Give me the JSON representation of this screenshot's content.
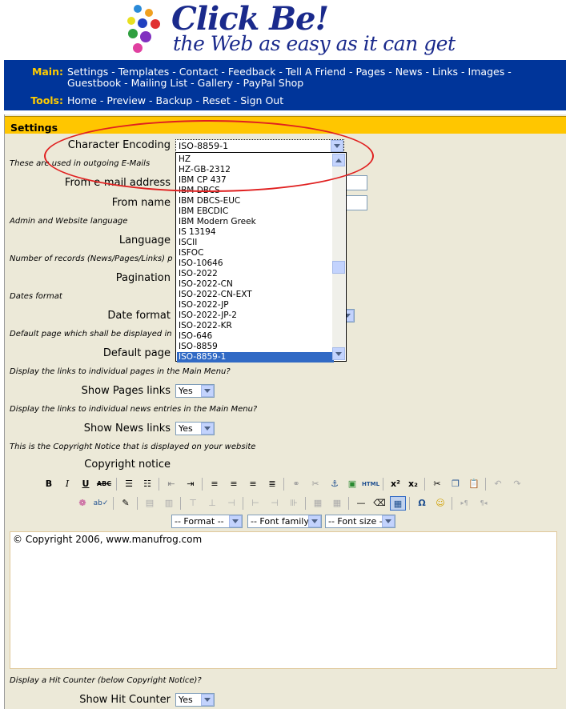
{
  "header": {
    "logo_title": "Click Be!",
    "logo_subtitle": "the Web as easy as it can get"
  },
  "nav": {
    "main_label": "Main:",
    "main_links_row1": [
      "Settings",
      "Templates",
      "Contact",
      "Feedback",
      "Tell A Friend",
      "Pages",
      "News",
      "Links",
      "Images"
    ],
    "main_links_row2": [
      "Guestbook",
      "Mailing List",
      "Gallery",
      "PayPal Shop"
    ],
    "tools_label": "Tools:",
    "tools_links": [
      "Home",
      "Preview",
      "Backup",
      "Reset",
      "Sign Out"
    ]
  },
  "settings": {
    "title": "Settings",
    "char_encoding_label": "Character Encoding",
    "char_encoding_value": "ISO-8859-1",
    "note_email": "These are used in outgoing E-Mails",
    "from_email_label": "From e-mail address",
    "from_name_label": "From name",
    "note_language": "Admin and Website language",
    "language_label": "Language",
    "note_pagination": "Number of records (News/Pages/Links) p",
    "pagination_label": "Pagination",
    "note_dates": "Dates format",
    "date_format_label": "Date format",
    "note_default_page": "Default page which shall be displayed in",
    "default_page_label": "Default page",
    "note_show_pages": "Display the links to individual pages in the Main Menu?",
    "show_pages_label": "Show Pages links",
    "show_pages_value": "Yes",
    "note_show_news": "Display the links to individual news entries in the Main Menu?",
    "show_news_label": "Show News links",
    "show_news_value": "Yes",
    "note_copyright": "This is the Copyright Notice that is displayed on your website",
    "copyright_label": "Copyright notice",
    "copyright_text": "© Copyright 2006, www.manufrog.com",
    "note_hit_counter": "Display a Hit Counter (below Copyright Notice)?",
    "hit_counter_label": "Show Hit Counter",
    "hit_counter_value": "Yes"
  },
  "encoding_options": [
    "HZ",
    "HZ-GB-2312",
    "IBM CP 437",
    "IBM DBCS",
    "IBM DBCS-EUC",
    "IBM EBCDIC",
    "IBM Modern Greek",
    "IS 13194",
    "ISCII",
    "ISFOC",
    "ISO-10646",
    "ISO-2022",
    "ISO-2022-CN",
    "ISO-2022-CN-EXT",
    "ISO-2022-JP",
    "ISO-2022-JP-2",
    "ISO-2022-KR",
    "ISO-646",
    "ISO-8859",
    "ISO-8859-1"
  ],
  "editor": {
    "format_select": "-- Format --",
    "font_family_select": "-- Font family --",
    "font_size_select": "-- Font size --"
  },
  "colors": {
    "nav_bg": "#00359a",
    "nav_label": "#ffcc00",
    "panel_header": "#ffc600",
    "panel_bg": "#ece9d8",
    "highlight_ellipse": "#e02020",
    "selected_option": "#316ac5"
  }
}
